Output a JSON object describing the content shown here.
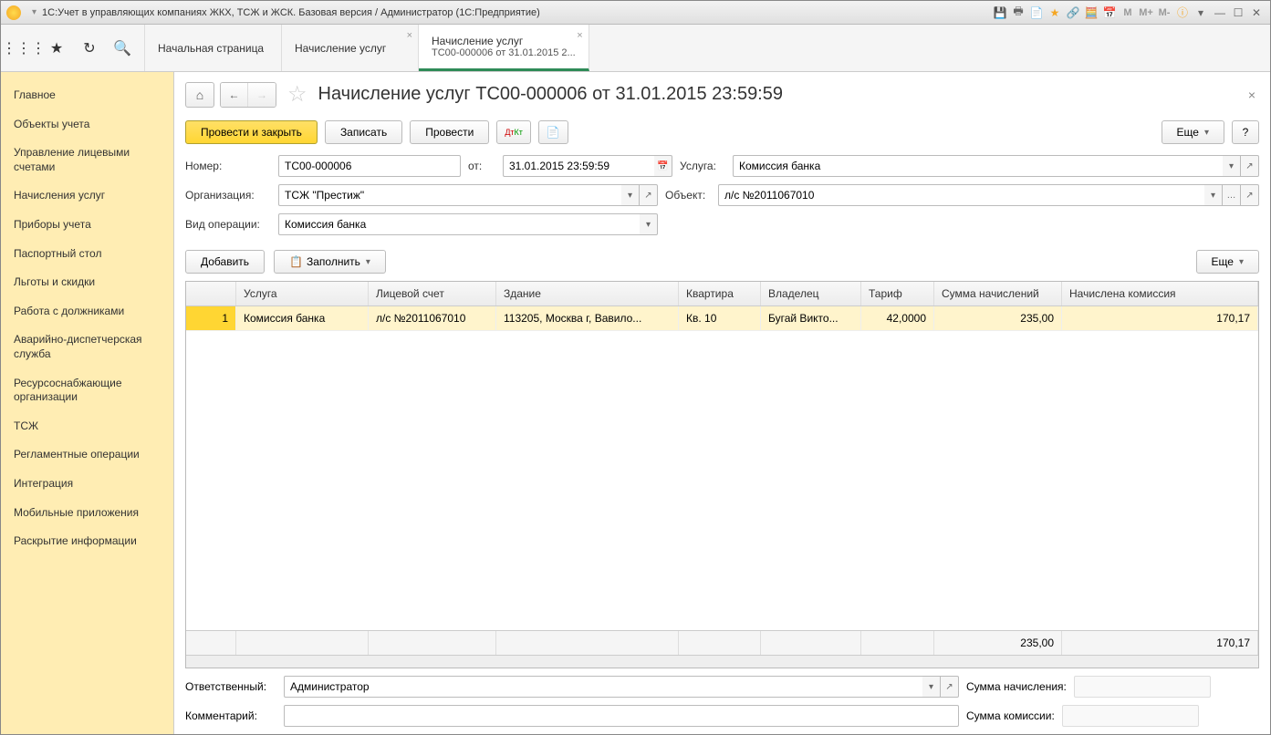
{
  "window_title": "1С:Учет в управляющих компаниях ЖКХ, ТСЖ и ЖСК. Базовая версия / Администратор  (1С:Предприятие)",
  "tabs": [
    {
      "label": "Начальная страница"
    },
    {
      "label": "Начисление услуг"
    },
    {
      "label": "Начисление услуг",
      "line2": "ТС00-000006 от 31.01.2015 2..."
    }
  ],
  "sidebar": {
    "items": [
      "Главное",
      "Объекты учета",
      "Управление лицевыми счетами",
      "Начисления услуг",
      "Приборы учета",
      "Паспортный стол",
      "Льготы и скидки",
      "Работа с должниками",
      "Аварийно-диспетчерская служба",
      "Ресурсоснабжающие организации",
      "ТСЖ",
      "Регламентные операции",
      "Интеграция",
      "Мобильные приложения",
      "Раскрытие информации"
    ]
  },
  "doc": {
    "title": "Начисление услуг ТС00-000006 от 31.01.2015 23:59:59",
    "buttons": {
      "post_close": "Провести и закрыть",
      "save": "Записать",
      "post": "Провести",
      "more": "Еще",
      "help": "?",
      "add": "Добавить",
      "fill": "Заполнить",
      "more2": "Еще"
    },
    "labels": {
      "number": "Номер:",
      "from": "от:",
      "service": "Услуга:",
      "org": "Организация:",
      "object": "Объект:",
      "op_type": "Вид операции:",
      "responsible": "Ответственный:",
      "comment": "Комментарий:",
      "total_charge": "Сумма начисления:",
      "total_comm": "Сумма комиссии:"
    },
    "fields": {
      "number": "ТС00-000006",
      "date": "31.01.2015 23:59:59",
      "service": "Комиссия банка",
      "org": "ТСЖ \"Престиж\"",
      "object": "л/с №2011067010",
      "op_type": "Комиссия банка",
      "responsible": "Администратор",
      "comment": ""
    }
  },
  "grid": {
    "headers": [
      "",
      "Услуга",
      "Лицевой счет",
      "Здание",
      "Квартира",
      "Владелец",
      "Тариф",
      "Сумма начислений",
      "Начислена комиссия"
    ],
    "rows": [
      {
        "n": "1",
        "service": "Комиссия банка",
        "account": "л/с №2011067010",
        "building": "113205, Москва г, Вавило...",
        "flat": "Кв. 10",
        "owner": "Бугай Викто...",
        "tariff": "42,0000",
        "charge": "235,00",
        "commission": "170,17"
      }
    ],
    "totals": {
      "charge": "235,00",
      "commission": "170,17"
    }
  },
  "titlebar_m": [
    "M",
    "M+",
    "M-"
  ]
}
